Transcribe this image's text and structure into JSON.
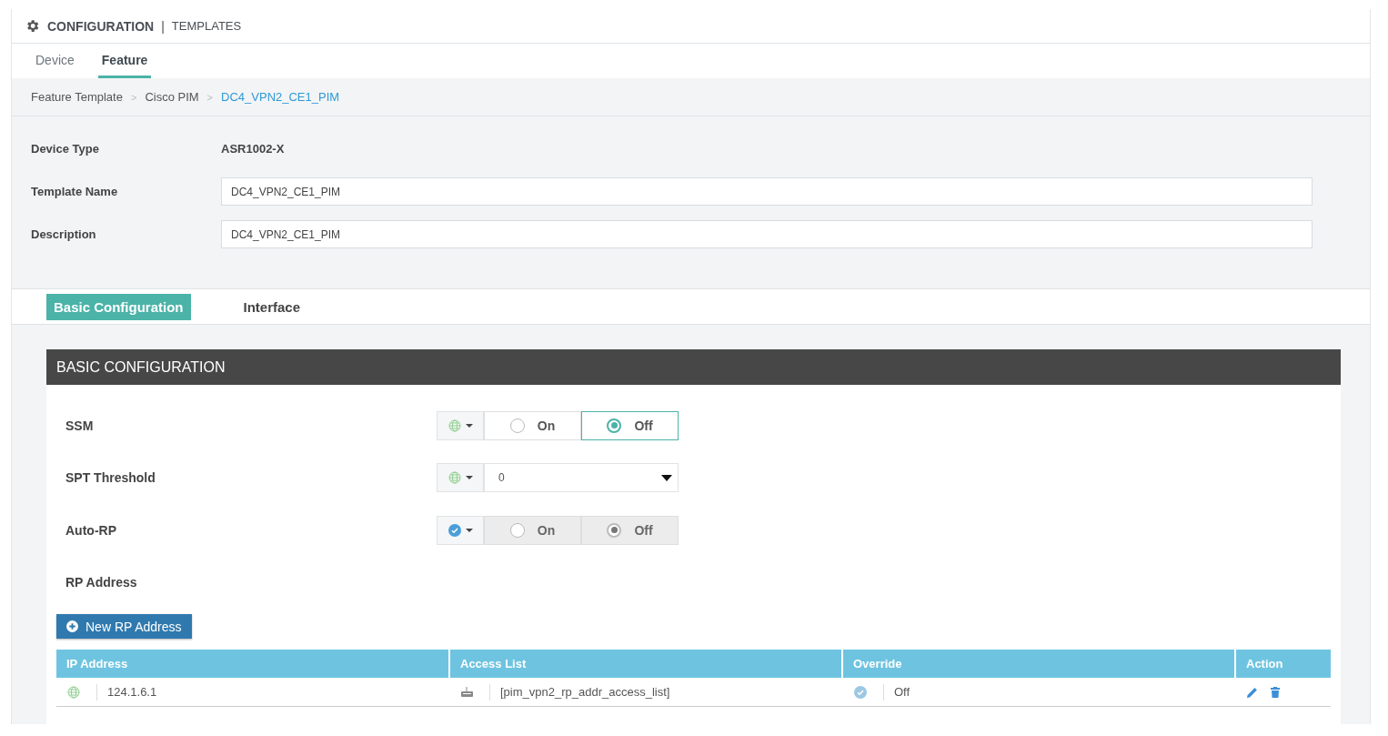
{
  "header": {
    "title": "CONFIGURATION",
    "separator": "|",
    "subtitle": "TEMPLATES"
  },
  "tabs": [
    {
      "label": "Device",
      "selected": false
    },
    {
      "label": "Feature",
      "selected": true
    }
  ],
  "breadcrumb": [
    {
      "label": "Feature Template",
      "current": false
    },
    {
      "separator_before": ">",
      "label": "Cisco PIM",
      "current": false
    },
    {
      "separator_before": ">",
      "label": "DC4_VPN2_CE1_PIM",
      "current": true
    }
  ],
  "form": [
    {
      "label": "Device Type",
      "kind": "text",
      "value": "ASR1002-X"
    },
    {
      "label": "Template Name",
      "kind": "input",
      "value": "DC4_VPN2_CE1_PIM"
    },
    {
      "label": "Description",
      "kind": "input",
      "value": "DC4_VPN2_CE1_PIM"
    }
  ],
  "section_tabs": [
    {
      "label": "Basic Configuration",
      "selected": true
    },
    {
      "label": "Interface",
      "selected": false
    }
  ],
  "panel": {
    "title": "BASIC CONFIGURATION",
    "settings": [
      {
        "label": "SSM",
        "kind": "radio",
        "default_scope": false,
        "disabled": false,
        "options": [
          {
            "label": "On",
            "selected": false
          },
          {
            "label": "Off",
            "selected": true
          }
        ]
      },
      {
        "label": "SPT Threshold",
        "kind": "select",
        "default_scope": false,
        "value": "0"
      },
      {
        "label": "Auto-RP",
        "kind": "radio",
        "default_scope": true,
        "disabled": true,
        "options": [
          {
            "label": "On",
            "selected": false
          },
          {
            "label": "Off",
            "selected": true
          }
        ]
      },
      {
        "label": "RP Address",
        "kind": "heading"
      }
    ],
    "add_button": "New RP Address",
    "table": {
      "columns": [
        "IP Address",
        "Access List",
        "Override",
        "Action"
      ],
      "rows": [
        {
          "ip": "124.1.6.1",
          "access_list": "[pim_vpn2_rp_addr_access_list]",
          "override": "Off"
        }
      ]
    }
  }
}
